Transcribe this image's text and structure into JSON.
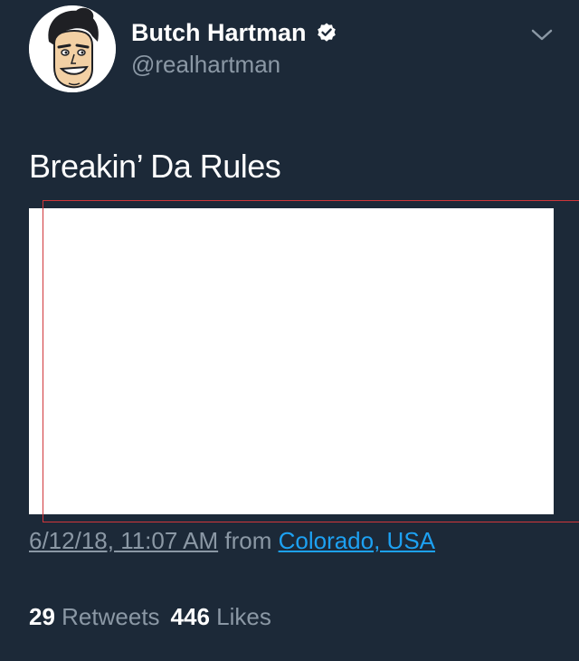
{
  "user": {
    "display_name": "Butch Hartman",
    "handle": "@realhartman",
    "verified_icon": "verified-badge-icon",
    "menu_icon": "chevron-down-icon"
  },
  "tweet": {
    "text": "Breakin’ Da Rules",
    "timestamp": "6/12/18, 11:07 AM",
    "from_label": "from",
    "location": "Colorado, USA"
  },
  "stats": {
    "retweets_count": "29",
    "retweets_label": "Retweets",
    "likes_count": "446",
    "likes_label": "Likes"
  },
  "colors": {
    "background": "#1c2938",
    "text_primary": "#ffffff",
    "text_secondary": "#8b98a5",
    "link": "#1da1f2",
    "highlight": "#d0363a"
  }
}
